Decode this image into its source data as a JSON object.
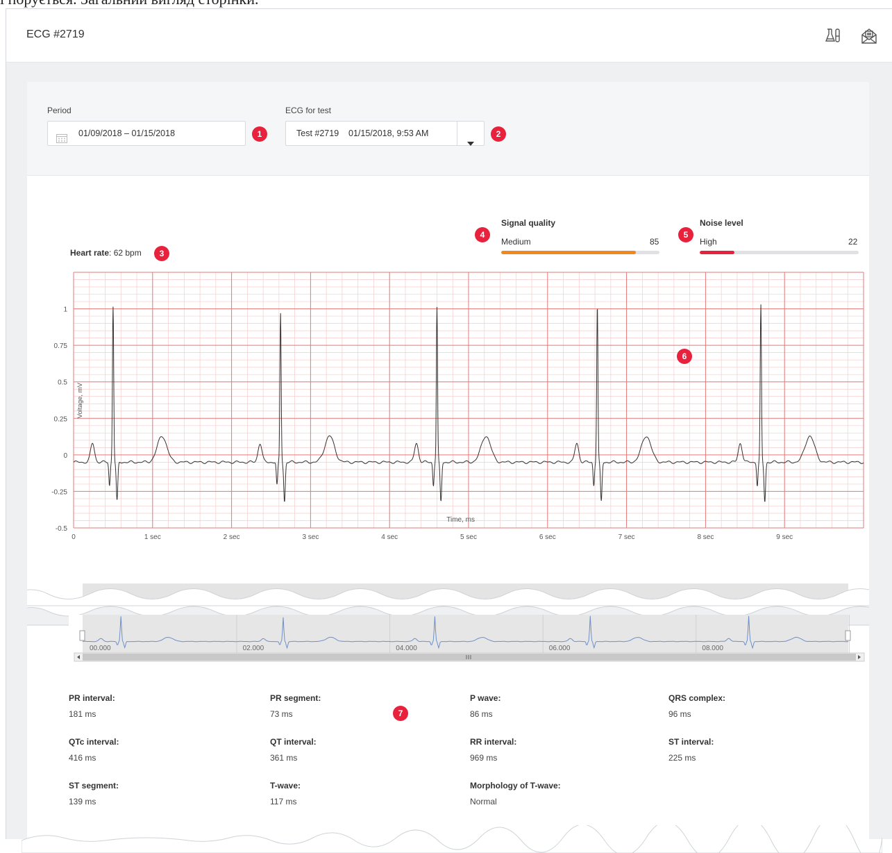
{
  "caption": "і порується. Загальний вигляд сторінки.",
  "header": {
    "title": "ECG #2719",
    "icons": [
      "lab-flask-icon",
      "mail-icon"
    ]
  },
  "filters": {
    "period_label": "Period",
    "period_value": "01/09/2018 – 01/15/2018",
    "ecg_label": "ECG for test",
    "ecg_test": "Test #2719",
    "ecg_datetime": "01/15/2018, 9:53 AM"
  },
  "badges": [
    "1",
    "2",
    "3",
    "4",
    "5",
    "6",
    "7"
  ],
  "heart_rate": {
    "label": "Heart rate",
    "value": ": 62 bpm"
  },
  "signal_quality": {
    "title": "Signal quality",
    "level": "Medium",
    "value": "85",
    "percent": 85,
    "color": "#f0881f"
  },
  "noise_level": {
    "title": "Noise level",
    "level": "High",
    "value": "22",
    "percent": 22,
    "color": "#e8213c"
  },
  "chart_data": {
    "type": "line",
    "xlabel": "Time, ms",
    "ylabel": "Voltage, mV",
    "xlim": [
      0,
      10
    ],
    "ylim": [
      -0.5,
      1.25
    ],
    "x_ticks": [
      "0",
      "1 sec",
      "2 sec",
      "3 sec",
      "4 sec",
      "5 sec",
      "6 sec",
      "7 sec",
      "8 sec",
      "9 sec"
    ],
    "y_ticks": [
      "1",
      "0.75",
      "0.5",
      "0.25",
      "0",
      "-0.25",
      "-0.5"
    ],
    "y_tick_values": [
      1,
      0.75,
      0.5,
      0.25,
      0,
      -0.25,
      -0.5
    ],
    "grid": true,
    "grid_color": "#e37a7a",
    "line_color": "#333333",
    "series": [
      {
        "r_peaks_sec": [
          0.5,
          2.62,
          4.6,
          6.63,
          8.7
        ],
        "r_peak_mv": [
          1.02,
          0.97,
          1.01,
          1.03,
          1.02
        ],
        "baseline_mv": -0.05
      }
    ]
  },
  "navigator": {
    "time_labels": [
      "00.000",
      "02.000",
      "04.000",
      "06.000",
      "08.000"
    ],
    "line_color": "#6e8fc7"
  },
  "stats": [
    {
      "label": "PR interval:",
      "value": "181 ms"
    },
    {
      "label": "PR segment:",
      "value": "73 ms"
    },
    {
      "label": "P wave:",
      "value": "86 ms"
    },
    {
      "label": "QRS complex:",
      "value": "96 ms"
    },
    {
      "label": "QTc interval:",
      "value": "416 ms"
    },
    {
      "label": "QT interval:",
      "value": "361 ms"
    },
    {
      "label": "RR interval:",
      "value": "969 ms"
    },
    {
      "label": "ST interval:",
      "value": "225 ms"
    },
    {
      "label": "ST segment:",
      "value": "139 ms"
    },
    {
      "label": "T-wave:",
      "value": "117 ms"
    },
    {
      "label": "Morphology of T-wave:",
      "value": "Normal"
    }
  ]
}
